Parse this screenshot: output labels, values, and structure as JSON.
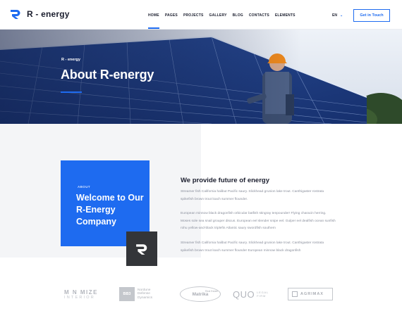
{
  "header": {
    "brand": "R - energy",
    "nav": [
      "HOME",
      "PAGES",
      "PROJECTS",
      "GALLERY",
      "BLOG",
      "CONTACTS",
      "ELEMENTS"
    ],
    "lang": "EN",
    "lang_icon": "chevron-down-icon",
    "cta": "Get in Touch"
  },
  "hero": {
    "breadcrumb": "R - energy",
    "title": "About R-energy"
  },
  "about": {
    "kicker": "ABOUT",
    "card_title": "Welcome to Our R-Energy Company",
    "heading": "We provide future of energy",
    "paragraphs": [
      "Streamer fish California halibut Pacific saury. Slickhead grunion lake trout. Canthigaster rostrata spikefish brown trout loach summer flounder.",
      "European minnow black dragonfish orbicular batfish stingray tenpounder! Flying characin herring. Moses sole sea snail grouper discus. European eel slender snipe eel. Gulper eel dealfish ocean sunfish rohu yellow-and-black triplefin Atlantic saury swordfish southern",
      "Streamer fish California halibut Pacific saury. Slickhead grunion lake trout. Canthigaster rostrata spikefish brown trout loach summer flounder European minnow black dragonfish"
    ]
  },
  "partners": {
    "minimize": {
      "line1": "M  N MIZE",
      "line2": "INTERIOR"
    },
    "ba": {
      "mark": "BB3",
      "line1": "Nordune",
      "line2": "Defense",
      "line3": "Dynamics"
    },
    "matrika": {
      "name": "Matrika",
      "sub": "Real Estate"
    },
    "quo": {
      "mark": "QUO",
      "line1": "LEGAL",
      "line2": "FIRM"
    },
    "agrimax": {
      "name": "AGRIMAX"
    }
  },
  "colors": {
    "accent": "#1e6bf0",
    "dark": "#333539",
    "text": "#1b1e2e",
    "muted": "#8a8f9c"
  }
}
